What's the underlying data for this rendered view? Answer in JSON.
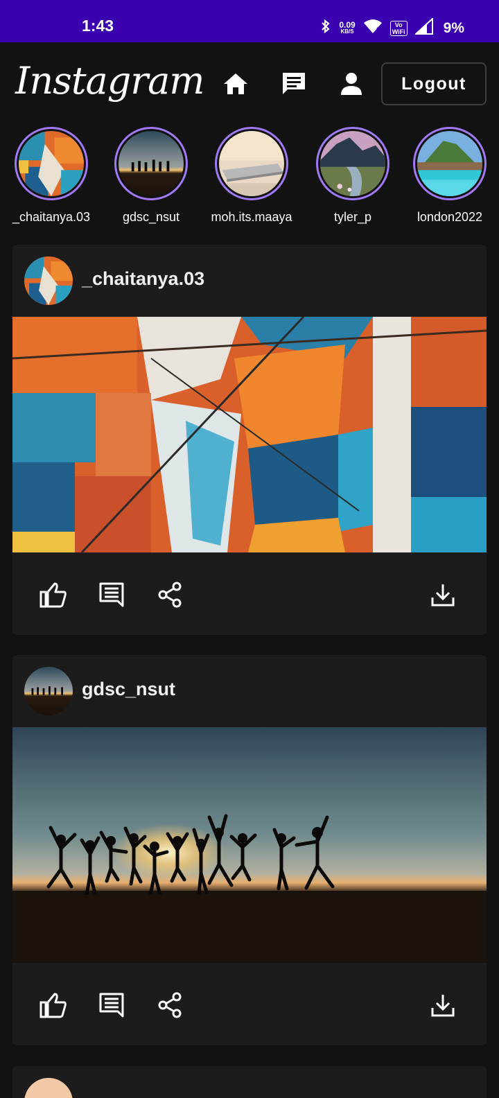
{
  "status_bar": {
    "time": "1:43",
    "net_speed_value": "0.09",
    "net_speed_unit": "KB/S",
    "volte_top": "Vo",
    "volte_bottom": "WiFi",
    "battery": "9%",
    "bg_color": "#3a00b0"
  },
  "header": {
    "logo": "Instagram",
    "logout_label": "Logout",
    "icons": [
      "home-icon",
      "chat-icon",
      "profile-icon"
    ]
  },
  "stories": [
    {
      "name": "_chaitanya.03",
      "image": "abstract-painting"
    },
    {
      "name": "gdsc_nsut",
      "image": "sunset-jumping-people"
    },
    {
      "name": "moh.its.maaya",
      "image": "laptop-desk"
    },
    {
      "name": "tyler_p",
      "image": "mountain-lake"
    },
    {
      "name": "london2022",
      "image": "tropical-resort"
    }
  ],
  "posts": [
    {
      "username": "_chaitanya.03",
      "image": "abstract-painting",
      "actions": [
        "like-icon",
        "comment-icon",
        "share-icon",
        "download-icon"
      ]
    },
    {
      "username": "gdsc_nsut",
      "image": "sunset-jumping-people",
      "actions": [
        "like-icon",
        "comment-icon",
        "share-icon",
        "download-icon"
      ]
    }
  ],
  "colors": {
    "background": "#121212",
    "card": "#1c1c1c",
    "story_ring": "#a07af4"
  }
}
